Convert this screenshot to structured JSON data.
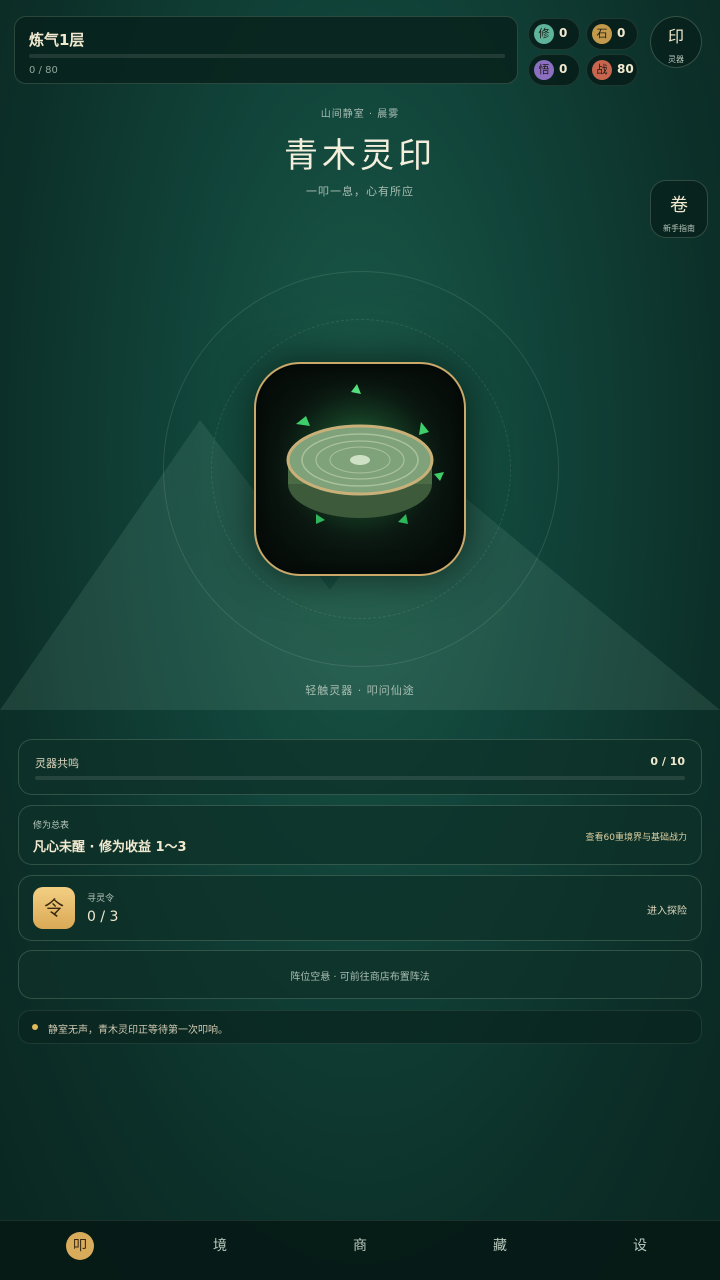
{
  "header": {
    "realm_title": "炼气1层",
    "realm_progress_text": "0 / 80",
    "realm_progress_fraction": 0.0,
    "stats": [
      {
        "icon": "修",
        "icon_color": "#5fb39a",
        "value": "0"
      },
      {
        "icon": "石",
        "icon_color": "#c39a4c",
        "value": "0"
      },
      {
        "icon": "悟",
        "icon_color": "#8d6fc1",
        "value": "0"
      },
      {
        "icon": "战",
        "icon_color": "#c8654e",
        "value": "80"
      }
    ],
    "seal_button": {
      "glyph": "印",
      "label": "灵器"
    }
  },
  "side_button": {
    "glyph": "卷",
    "label": "新手指南"
  },
  "hero": {
    "location": "山间静室 · 晨雾",
    "title": "青木灵印",
    "subtitle": "一叩一息，心有所应",
    "tap_hint": "轻触灵器 · 叩问仙途"
  },
  "resonance": {
    "label": "灵器共鸣",
    "count": "0 / 10",
    "fraction": 0.0
  },
  "cultivation": {
    "label": "修为总表",
    "value": "凡心未醒 · 修为收益 1～3",
    "link": "查看60重境界与基础战力"
  },
  "token": {
    "icon": "令",
    "label": "寻灵令",
    "count": "0 / 3",
    "link": "进入探险"
  },
  "formation": {
    "text": "阵位空悬 · 可前往商店布置阵法"
  },
  "log": {
    "text": "静室无声，青木灵印正等待第一次叩响。"
  },
  "nav": [
    {
      "glyph": "叩",
      "active": true
    },
    {
      "glyph": "境",
      "active": false
    },
    {
      "glyph": "商",
      "active": false
    },
    {
      "glyph": "藏",
      "active": false
    },
    {
      "glyph": "设",
      "active": false
    }
  ],
  "colors": {
    "accent_gold": "#d6b873",
    "background": "#11443a"
  }
}
